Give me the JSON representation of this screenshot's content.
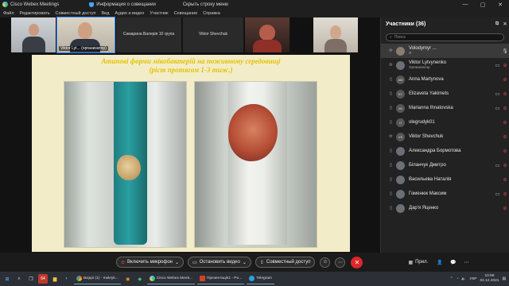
{
  "app": {
    "title": "Cisco Webex Meetings",
    "info_label": "Информация о совещании",
    "hide_label": "Скрыть строку меню",
    "window_controls": [
      "—",
      "▢",
      "✕"
    ]
  },
  "menu": [
    "Файл",
    "Редактировать",
    "Совместный доступ",
    "Вид",
    "Аудио и видео",
    "Участник",
    "Совещание",
    "Справка"
  ],
  "thumbnails": [
    {
      "name": ""
    },
    {
      "name": "Viktor Lyt...  (организатор)"
    },
    {
      "name": "Самарина Валерія 10 група"
    },
    {
      "name": "Viktor Shevchuk"
    },
    {
      "name": ""
    },
    {
      "name": ""
    },
    {
      "name": ""
    }
  ],
  "slide": {
    "title_line1": "Атипові форми мікобактерій на поживному середовищі",
    "title_line2": "(ріст протягом 1-3 тиж.)"
  },
  "panel": {
    "title": "Участники (36)",
    "search_placeholder": "Поиск",
    "participants": [
      {
        "initials": "",
        "name": "Volodymyr ...",
        "role": "Я",
        "device": "⟳",
        "mic": "🎙",
        "cam": "",
        "selected": true
      },
      {
        "initials": "",
        "name": "Viktor Lytvynenko",
        "role": "Организатор",
        "device": "⟳",
        "mic": "⊘",
        "cam": "▭",
        "selected": false
      },
      {
        "initials": "AM",
        "name": "Anna Martynova",
        "role": "",
        "device": "▯",
        "mic": "⊘",
        "cam": "",
        "selected": false
      },
      {
        "initials": "EY",
        "name": "Elizaveta Yakimets",
        "role": "",
        "device": "▯",
        "mic": "⊘",
        "cam": "▭",
        "selected": false
      },
      {
        "initials": "MI",
        "name": "Marianna Ihnatovska",
        "role": "",
        "device": "▯",
        "mic": "⊘",
        "cam": "▭",
        "selected": false
      },
      {
        "initials": "O",
        "name": "olegrudyk01",
        "role": "",
        "device": "▯",
        "mic": "⊘",
        "cam": "",
        "selected": false
      },
      {
        "initials": "VS",
        "name": "Viktor Shevchuk",
        "role": "",
        "device": "⟳",
        "mic": "⊘",
        "cam": "",
        "selected": false
      },
      {
        "initials": "",
        "name": "Александра Бормотова",
        "role": "",
        "device": "▯",
        "mic": "⊘",
        "cam": "",
        "selected": false
      },
      {
        "initials": "",
        "name": "Біланчук Дмитро",
        "role": "",
        "device": "▯",
        "mic": "⊘",
        "cam": "▭",
        "selected": false
      },
      {
        "initials": "",
        "name": "Васильева Наталія",
        "role": "",
        "device": "▯",
        "mic": "⊘",
        "cam": "",
        "selected": false
      },
      {
        "initials": "",
        "name": "Гоменюк Максим",
        "role": "",
        "device": "▯",
        "mic": "⊘",
        "cam": "▭",
        "selected": false
      },
      {
        "initials": "",
        "name": "Дар'я Яценко",
        "role": "",
        "device": "▯",
        "mic": "⊘",
        "cam": "",
        "selected": false
      }
    ]
  },
  "controls": {
    "unmute_label": "Включить микрофон",
    "stop_video_label": "Остановить видео",
    "share_label": "Совместный доступ",
    "apps_label": "Прил."
  },
  "taskbar": {
    "browser_label": "Вхідні (1) - meleyk...",
    "webex_label": "Cisco Webex Meeti...",
    "ppt_label": "Презентація1 - Po...",
    "telegram_label": "Telegram",
    "lang": "УКР",
    "time": "10:59",
    "date": "02.12.2021"
  },
  "colors": {
    "slide_title": "#e3c300",
    "end_call": "#e0262b",
    "muted_mic": "#e04848"
  }
}
